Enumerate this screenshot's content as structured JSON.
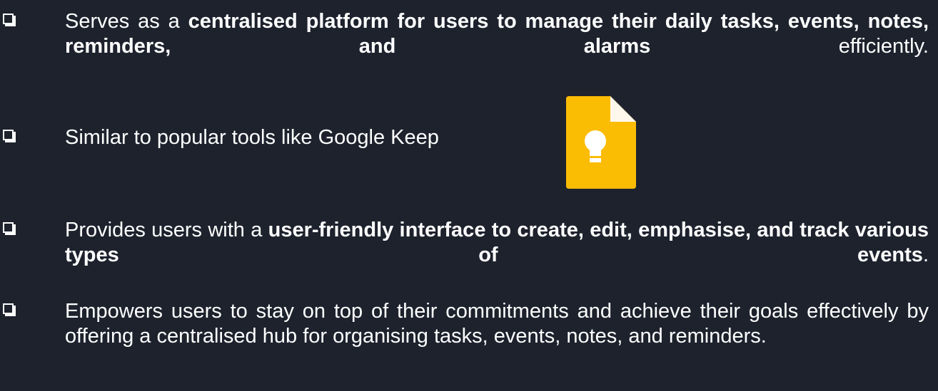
{
  "bullets": [
    {
      "id": "b1",
      "parts": [
        {
          "text": "Serves as a ",
          "bold": false
        },
        {
          "text": "centralised platform for users to manage their daily tasks, events, notes, reminders, and alarms",
          "bold": true
        },
        {
          "text": " efficiently.",
          "bold": false
        }
      ]
    },
    {
      "id": "b2",
      "parts": [
        {
          "text": "Similar to popular tools like Google Keep",
          "bold": false
        }
      ]
    },
    {
      "id": "b3",
      "parts": [
        {
          "text": "Provides users with a ",
          "bold": false
        },
        {
          "text": "user-friendly interface to create, edit, emphasise, and track various types of events",
          "bold": true
        },
        {
          "text": ".",
          "bold": false
        }
      ]
    },
    {
      "id": "b4",
      "parts": [
        {
          "text": "Empowers users to stay on top of their commitments and achieve their goals effectively by offering a centralised hub for organising tasks, events, notes, and reminders.",
          "bold": false
        }
      ]
    }
  ],
  "logo": {
    "icon": "google-keep-icon",
    "colors": {
      "body": "#fbbc04",
      "fold": "#f29900",
      "bulb": "#ffffff"
    }
  },
  "colors": {
    "background": "#1d222d",
    "text": "#ffffff"
  }
}
